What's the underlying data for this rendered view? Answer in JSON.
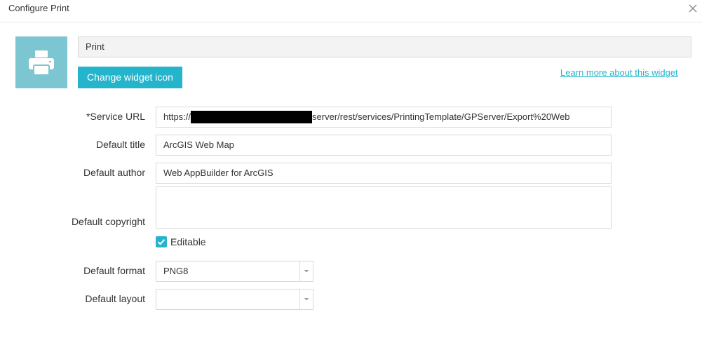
{
  "dialog": {
    "title": "Configure Print",
    "close_icon": "close-icon"
  },
  "widget": {
    "icon": "printer-icon",
    "icon_bg_color": "#7cc6d2",
    "name_value": "Print",
    "change_icon_label": "Change widget icon",
    "learn_more_label": "Learn more about this widget",
    "accent_color": "#24b5cc"
  },
  "form": {
    "service_url": {
      "label": "*Service URL",
      "value_prefix": "https://",
      "value_suffix": "server/rest/services/PrintingTemplate/GPServer/Export%20Web"
    },
    "default_title": {
      "label": "Default title",
      "value": "ArcGIS Web Map"
    },
    "default_author": {
      "label": "Default author",
      "value": "Web AppBuilder for ArcGIS"
    },
    "default_copyright": {
      "label": "Default copyright",
      "value": ""
    },
    "editable": {
      "label": "Editable",
      "checked": true
    },
    "default_format": {
      "label": "Default format",
      "value": "PNG8"
    },
    "default_layout": {
      "label": "Default layout",
      "value": ""
    }
  }
}
